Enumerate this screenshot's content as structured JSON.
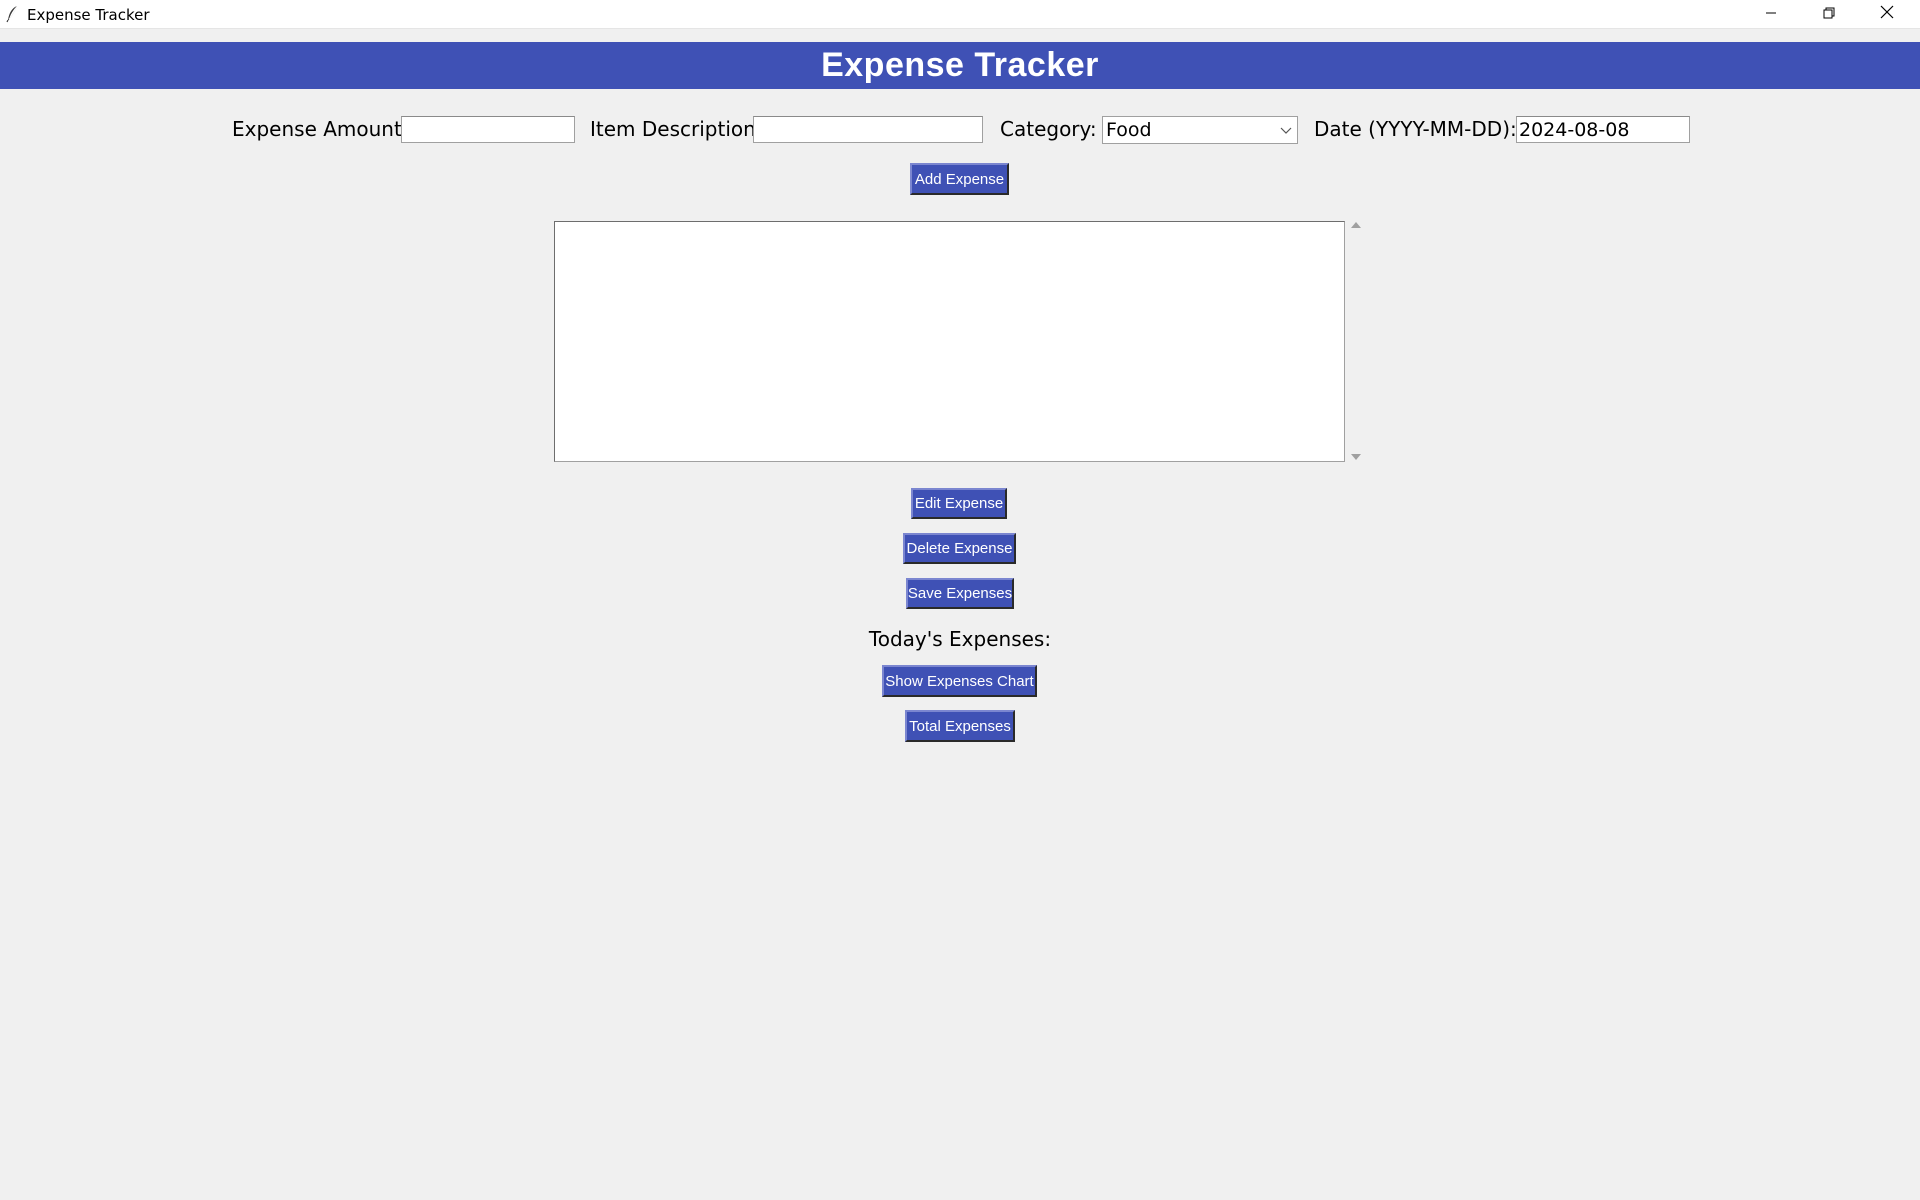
{
  "window": {
    "title": "Expense Tracker"
  },
  "header": {
    "title": "Expense Tracker",
    "background": "#3f51b5"
  },
  "form": {
    "amount_label": "Expense Amount:",
    "amount_value": "",
    "description_label": "Item Description:",
    "description_value": "",
    "category_label": "Category:",
    "category_value": "Food",
    "date_label": "Date (YYYY-MM-DD):",
    "date_value": "2024-08-08"
  },
  "buttons": {
    "add": "Add Expense",
    "edit": "Edit Expense",
    "delete": "Delete Expense",
    "save": "Save Expenses",
    "chart": "Show Expenses Chart",
    "total": "Total Expenses"
  },
  "expense_list": {
    "items": []
  },
  "today_label": "Today's Expenses:",
  "icons": {
    "app": "feather-icon",
    "minimize": "minimize-icon",
    "maximize": "restore-icon",
    "close": "close-icon",
    "dropdown": "chevron-down-icon",
    "scroll_up": "triangle-up-icon",
    "scroll_down": "triangle-down-icon"
  },
  "colors": {
    "accent": "#3f51b5",
    "background": "#f0f0f0"
  }
}
